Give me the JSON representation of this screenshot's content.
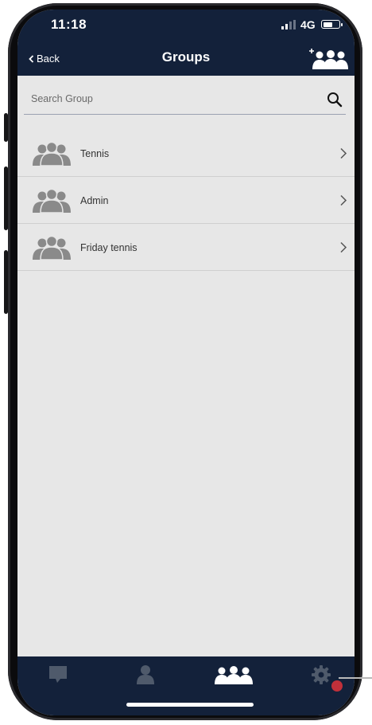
{
  "status_bar": {
    "time": "11:18",
    "network": "4G",
    "battery_level": 0.6
  },
  "nav": {
    "back_label": "Back",
    "title": "Groups"
  },
  "search": {
    "placeholder": "Search Group",
    "value": ""
  },
  "groups": [
    {
      "label": "Tennis"
    },
    {
      "label": "Admin"
    },
    {
      "label": "Friday tennis"
    }
  ],
  "tabbar": {
    "items": [
      "messages-icon",
      "contact-icon",
      "groups-icon",
      "settings-icon"
    ],
    "active": "groups-icon"
  },
  "colors": {
    "navbar": "#13213a",
    "background": "#e7e7e7",
    "inactive_icon": "#4f5a6b",
    "active_icon": "#ffffff",
    "settings_dot": "#c0303a"
  }
}
